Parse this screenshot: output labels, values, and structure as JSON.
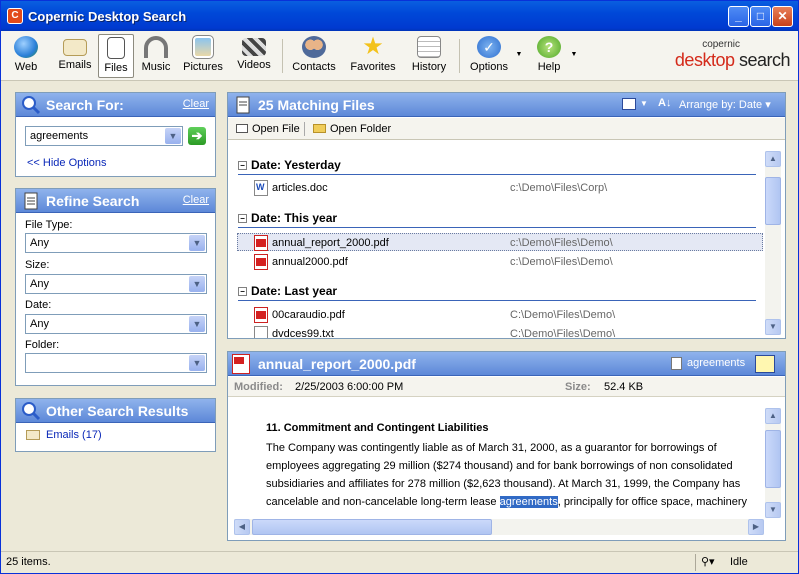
{
  "window": {
    "title": "Copernic Desktop Search"
  },
  "toolbar": {
    "items": [
      {
        "label": "Web",
        "icon": "globe-icon"
      },
      {
        "label": "Emails",
        "icon": "envelope-icon"
      },
      {
        "label": "Files",
        "icon": "document-icon"
      },
      {
        "label": "Music",
        "icon": "headphones-icon"
      },
      {
        "label": "Pictures",
        "icon": "picture-icon"
      },
      {
        "label": "Videos",
        "icon": "clapperboard-icon"
      },
      {
        "label": "Contacts",
        "icon": "people-icon"
      },
      {
        "label": "Favorites",
        "icon": "star-icon"
      },
      {
        "label": "History",
        "icon": "calendar-icon"
      },
      {
        "label": "Options",
        "icon": "checkmark-icon"
      },
      {
        "label": "Help",
        "icon": "question-icon"
      }
    ],
    "active": "Files",
    "logo_small": "copernic",
    "logo_big_a": "desktop",
    "logo_big_b": " search"
  },
  "search_for": {
    "title": "Search For:",
    "clear": "Clear",
    "query": "agreements",
    "hide_options": "<< Hide Options"
  },
  "refine": {
    "title": "Refine Search",
    "clear": "Clear",
    "file_type_label": "File Type:",
    "file_type_value": "Any",
    "size_label": "Size:",
    "size_value": "Any",
    "date_label": "Date:",
    "date_value": "Any",
    "folder_label": "Folder:",
    "folder_value": ""
  },
  "other": {
    "title": "Other Search Results",
    "emails": "Emails (17)"
  },
  "results": {
    "title": "25 Matching Files",
    "arrange": "Arrange by: Date",
    "open_file": "Open File",
    "open_folder": "Open Folder",
    "groups": [
      {
        "label": "Date: Yesterday",
        "files": [
          {
            "name": "articles.doc",
            "path": "c:\\Demo\\Files\\Corp\\",
            "type": "doc"
          }
        ]
      },
      {
        "label": "Date: This year",
        "files": [
          {
            "name": "annual_report_2000.pdf",
            "path": "c:\\Demo\\Files\\Demo\\",
            "type": "pdf"
          },
          {
            "name": "annual2000.pdf",
            "path": "c:\\Demo\\Files\\Demo\\",
            "type": "pdf"
          }
        ]
      },
      {
        "label": "Date: Last year",
        "files": [
          {
            "name": "00caraudio.pdf",
            "path": "C:\\Demo\\Files\\Demo\\",
            "type": "pdf"
          },
          {
            "name": "dvdces99.txt",
            "path": "C:\\Demo\\Files\\Demo\\",
            "type": "txt"
          }
        ]
      }
    ]
  },
  "preview": {
    "filename": "annual_report_2000.pdf",
    "highlight_term": "agreements",
    "modified_label": "Modified:",
    "modified_value": "2/25/2003 6:00:00 PM",
    "size_label": "Size:",
    "size_value": "52.4 KB",
    "heading": "11. Commitment and Contingent Liabilities",
    "line1": "The Company was contingently liable as of March 31, 2000, as a guarantor for borrowings of",
    "line2": "employees aggregating 29 million ($274 thousand) and for bank borrowings of non consolidated",
    "line3": "subsidiaries and affiliates for 278 million ($2,623 thousand). At March 31, 1999, the Company has",
    "line4a": "cancelable and non-cancelable long-term lease ",
    "line4hl": "agreements",
    "line4b": ", principally for office space, machinery"
  },
  "status": {
    "items": "25 items.",
    "state": "Idle"
  }
}
